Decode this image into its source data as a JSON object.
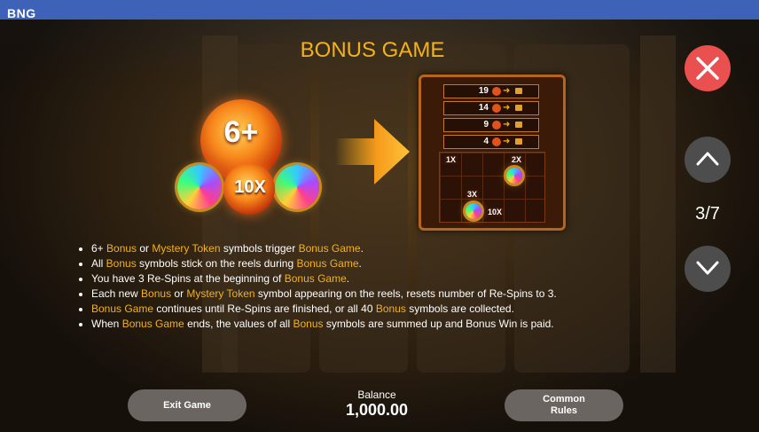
{
  "brand": "BNG",
  "title": "BONUS GAME",
  "artwork": {
    "count_label": "6+",
    "center_multiplier": "10X"
  },
  "board": {
    "rows": [
      {
        "count": "19"
      },
      {
        "count": "14"
      },
      {
        "count": "9"
      },
      {
        "count": "4"
      }
    ],
    "multipliers": [
      "1X",
      "2X",
      "3X",
      "10X"
    ]
  },
  "rules": [
    [
      {
        "t": "6+ "
      },
      {
        "t": "Bonus",
        "hl": true
      },
      {
        "t": " or "
      },
      {
        "t": "Mystery Token",
        "hl": true
      },
      {
        "t": " symbols trigger "
      },
      {
        "t": "Bonus Game",
        "hl": true
      },
      {
        "t": "."
      }
    ],
    [
      {
        "t": "All "
      },
      {
        "t": "Bonus",
        "hl": true
      },
      {
        "t": " symbols stick on the reels during "
      },
      {
        "t": "Bonus Game",
        "hl": true
      },
      {
        "t": "."
      }
    ],
    [
      {
        "t": "You have 3 Re-Spins at the beginning of "
      },
      {
        "t": "Bonus Game",
        "hl": true
      },
      {
        "t": "."
      }
    ],
    [
      {
        "t": "Each new "
      },
      {
        "t": "Bonus",
        "hl": true
      },
      {
        "t": " or "
      },
      {
        "t": "Mystery Token",
        "hl": true
      },
      {
        "t": " symbol appearing on the reels, resets number of Re-Spins to 3."
      }
    ],
    [
      {
        "t": "Bonus Game",
        "hl": true
      },
      {
        "t": " continues until Re-Spins are finished, or all 40 "
      },
      {
        "t": "Bonus",
        "hl": true
      },
      {
        "t": " symbols are collected."
      }
    ],
    [
      {
        "t": "When "
      },
      {
        "t": "Bonus Game",
        "hl": true
      },
      {
        "t": " ends, the values of all "
      },
      {
        "t": "Bonus",
        "hl": true
      },
      {
        "t": " symbols are summed up and Bonus Win is paid."
      }
    ]
  ],
  "nav": {
    "page_indicator": "3/7"
  },
  "footer": {
    "exit_label": "Exit Game",
    "balance_label": "Balance",
    "balance_value": "1,000.00",
    "rules_label": "Common Rules"
  },
  "colors": {
    "accent": "#f2b21c",
    "close": "#ea5050",
    "nav_button": "#4d4d4d",
    "topbar": "#3e62b8"
  }
}
